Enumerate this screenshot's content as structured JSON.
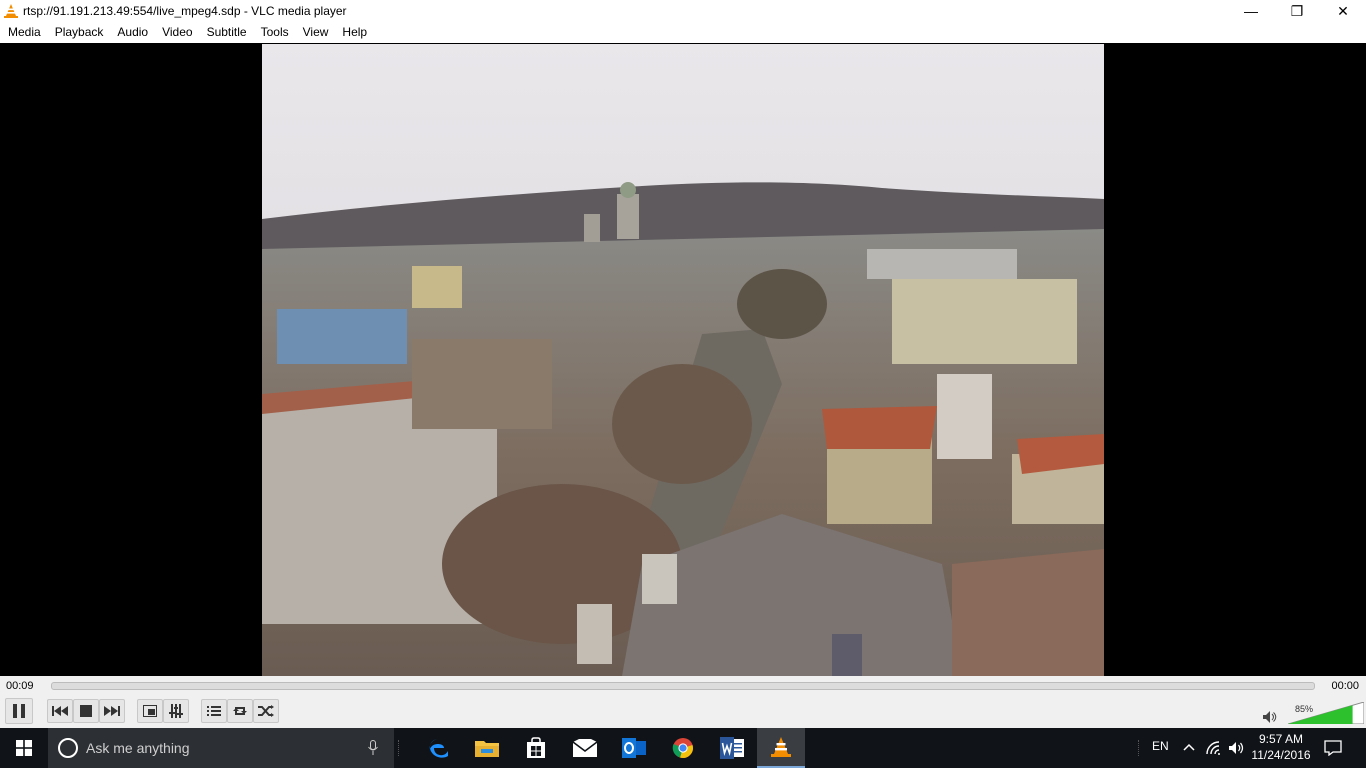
{
  "window": {
    "title": "rtsp://91.191.213.49:554/live_mpeg4.sdp - VLC media player",
    "buttons": {
      "minimize": "—",
      "restore": "❐",
      "close": "✕"
    }
  },
  "menu": [
    "Media",
    "Playback",
    "Audio",
    "Video",
    "Subtitle",
    "Tools",
    "View",
    "Help"
  ],
  "player": {
    "elapsed": "00:09",
    "total": "00:00",
    "volume_percent": "85%",
    "volume_level": 0.85,
    "state": "playing"
  },
  "taskbar": {
    "search_placeholder": "Ask me anything",
    "language": "EN",
    "time": "9:57 AM",
    "date": "11/24/2016"
  },
  "colors": {
    "vlc_orange": "#f28c00",
    "volume_green": "#2ec12e",
    "taskbar_bg": "#101418"
  }
}
